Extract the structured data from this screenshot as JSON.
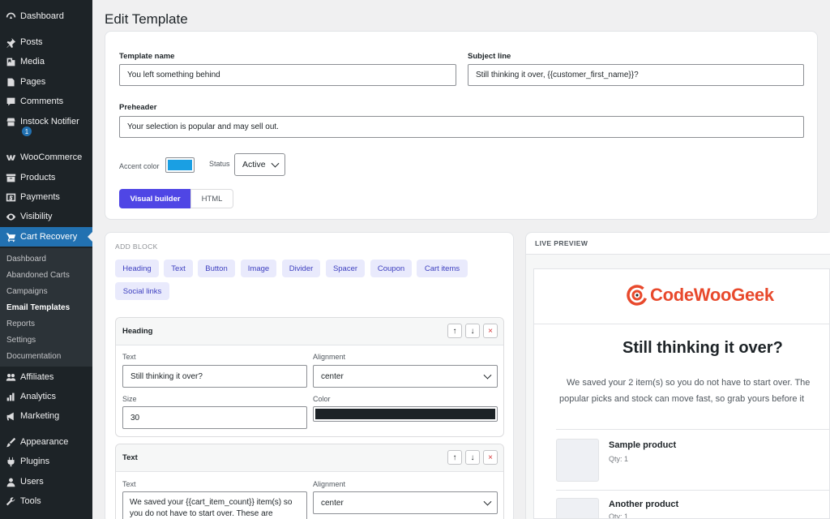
{
  "sidebar": {
    "items": [
      {
        "label": "Dashboard",
        "icon": "dashboard-icon"
      },
      {
        "label": "Posts",
        "icon": "pin-icon"
      },
      {
        "label": "Media",
        "icon": "media-icon"
      },
      {
        "label": "Pages",
        "icon": "pages-icon"
      },
      {
        "label": "Comments",
        "icon": "comment-icon"
      },
      {
        "label": "Instock Notifier",
        "icon": "store-icon"
      },
      {
        "label": "WooCommerce",
        "icon": "woo-icon"
      },
      {
        "label": "Products",
        "icon": "archive-icon"
      },
      {
        "label": "Payments",
        "icon": "dollar-icon"
      },
      {
        "label": "Visibility",
        "icon": "eye-icon"
      },
      {
        "label": "Cart Recovery",
        "icon": "cart-icon"
      },
      {
        "label": "Affiliates",
        "icon": "groups-icon"
      },
      {
        "label": "Analytics",
        "icon": "chart-icon"
      },
      {
        "label": "Marketing",
        "icon": "megaphone-icon"
      },
      {
        "label": "Appearance",
        "icon": "brush-icon"
      },
      {
        "label": "Plugins",
        "icon": "plug-icon"
      },
      {
        "label": "Users",
        "icon": "user-icon"
      },
      {
        "label": "Tools",
        "icon": "wrench-icon"
      }
    ],
    "instock_badge": "1",
    "submenu": [
      "Dashboard",
      "Abandoned Carts",
      "Campaigns",
      "Email Templates",
      "Reports",
      "Settings",
      "Documentation"
    ]
  },
  "page": {
    "title": "Edit Template"
  },
  "form": {
    "template_name_label": "Template name",
    "template_name_value": "You left something behind",
    "subject_label": "Subject line",
    "subject_value": "Still thinking it over, {{customer_first_name}}?",
    "preheader_label": "Preheader",
    "preheader_value": "Your selection is popular and may sell out.",
    "accent_label": "Accent color",
    "accent_color": "#1a9fe3",
    "status_label": "Status",
    "status_value": "Active",
    "mode_visual": "Visual builder",
    "mode_html": "HTML"
  },
  "builder": {
    "add_block_label": "ADD BLOCK",
    "block_types": [
      "Heading",
      "Text",
      "Button",
      "Image",
      "Divider",
      "Spacer",
      "Coupon",
      "Cart items",
      "Social links"
    ],
    "blocks": [
      {
        "title": "Heading",
        "text_label": "Text",
        "text_value": "Still thinking it over?",
        "alignment_label": "Alignment",
        "alignment_value": "center",
        "size_label": "Size",
        "size_value": "30",
        "color_label": "Color",
        "color_value": "#1d2327"
      },
      {
        "title": "Text",
        "text_label": "Text",
        "text_value": "We saved your {{cart_item_count}} item(s) so you do not have to start over. These are",
        "alignment_label": "Alignment",
        "alignment_value": "center"
      }
    ],
    "up_arrow": "↑",
    "down_arrow": "↓",
    "delete": "×"
  },
  "preview": {
    "label": "LIVE PREVIEW",
    "logo_text": "CodeWooGeek",
    "logo_color": "#e8492c",
    "heading": "Still thinking it over?",
    "body_line1": "We saved your 2 item(s) so you do not have to start over. The",
    "body_line2": "popular picks and stock can move fast, so grab yours before it",
    "products": [
      {
        "name": "Sample product",
        "qty": "Qty: 1"
      },
      {
        "name": "Another product",
        "qty": "Qty: 1"
      }
    ]
  },
  "colors": {
    "primary": "#4f46e5",
    "wp_blue": "#2271b1",
    "sidebar": "#1d2327"
  }
}
